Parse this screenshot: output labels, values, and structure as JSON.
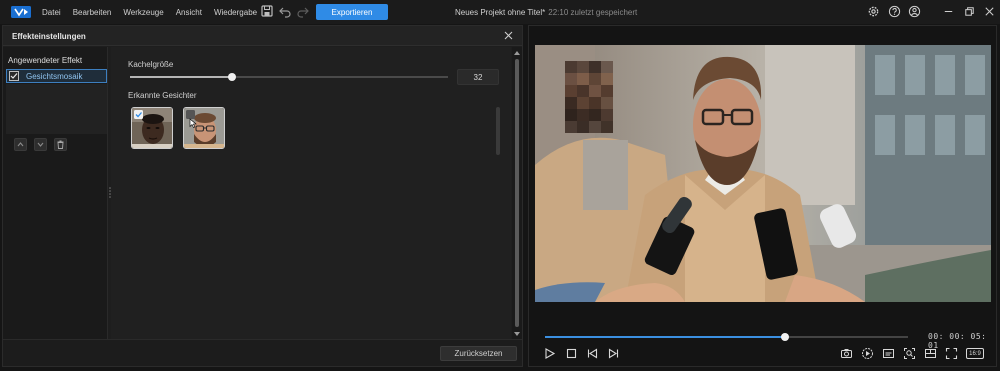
{
  "app": {
    "menu": [
      "Datei",
      "Bearbeiten",
      "Werkzeuge",
      "Ansicht",
      "Wiedergabe"
    ],
    "export_label": "Exportieren",
    "project_title": "Neues Projekt ohne Titel*",
    "saved_status": "22:10 zuletzt gespeichert",
    "colors": {
      "accent": "#2f8be6",
      "background": "#151515",
      "panel": "#1e1e1e"
    }
  },
  "dialog": {
    "title": "Effekteinstellungen",
    "applied_effect_header": "Angewendeter Effekt",
    "effects": [
      {
        "label": "Gesichtsmosaik",
        "checked": true
      }
    ],
    "tile_size_label": "Kachelgröße",
    "tile_size_value": "32",
    "tile_size_fraction": 0.32,
    "detected_faces_label": "Erkannte Gesichter",
    "faces": [
      {
        "name": "face-1",
        "selected": true
      },
      {
        "name": "face-2",
        "selected": false
      }
    ],
    "reset_label": "Zurücksetzen"
  },
  "player": {
    "timecode": "00: 00: 05: 01",
    "progress_fraction": 0.66,
    "aspect_ratio": "16:9"
  }
}
